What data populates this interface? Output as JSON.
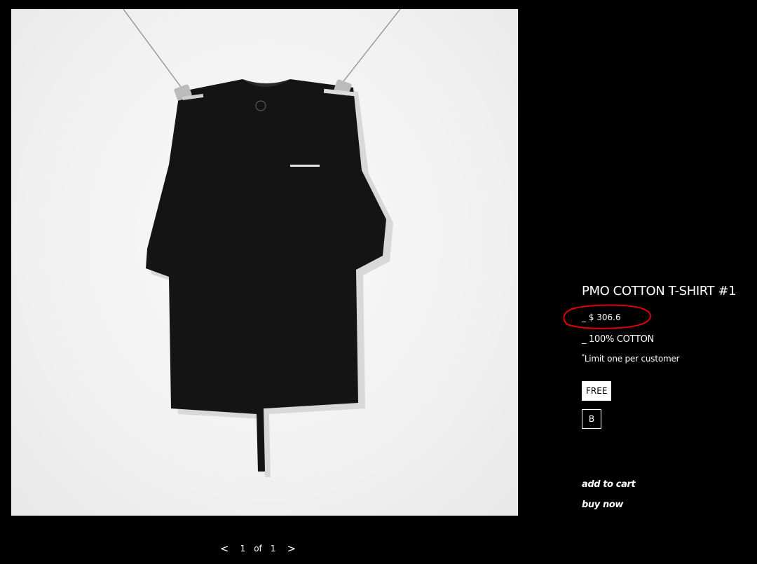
{
  "product": {
    "title": "PMO COTTON T-SHIRT #1",
    "price_prefix": "_",
    "price": "$ 306.6",
    "material_prefix": "_",
    "material": "100% COTTON",
    "limit_mark": "*",
    "limit_text": "Limit one per customer"
  },
  "sizes": {
    "selected": "FREE",
    "other": "B"
  },
  "actions": {
    "add_to_cart": "add to cart",
    "buy_now": "buy now"
  },
  "pager": {
    "prev": "<",
    "current": "1",
    "of": "of",
    "total": "1",
    "next": ">"
  },
  "colors": {
    "background": "#000000",
    "text": "#ffffff",
    "highlight_circle": "#e00000",
    "photo_background": "#f2f2f2",
    "shirt": "#141414"
  },
  "icons": {
    "prev": "chevron-left-icon",
    "next": "chevron-right-icon"
  }
}
